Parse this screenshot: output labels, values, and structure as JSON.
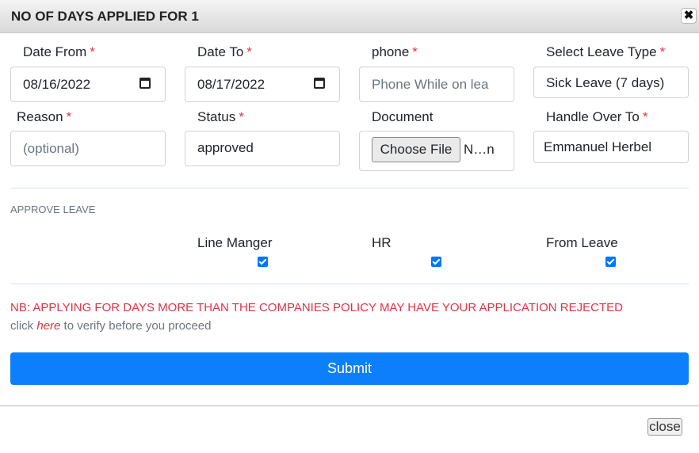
{
  "dialog": {
    "title": "NO OF DAYS APPLIED FOR 1",
    "close_x": "✖"
  },
  "form": {
    "date_from": {
      "label": "Date From",
      "value": "08/16/2022"
    },
    "date_to": {
      "label": "Date To",
      "value": "08/17/2022"
    },
    "phone": {
      "label": "phone",
      "placeholder": "Phone While on lea"
    },
    "leave_type": {
      "label": "Select Leave Type",
      "value": "Sick Leave (7 days)"
    },
    "reason": {
      "label": "Reason",
      "placeholder": "(optional)"
    },
    "status": {
      "label": "Status",
      "value": "approved"
    },
    "document": {
      "label": "Document",
      "button": "Choose File",
      "filename": "N…n"
    },
    "handle_over": {
      "label": "Handle Over To",
      "value": "Emmanuel Herbel"
    },
    "required_mark": "*"
  },
  "approve": {
    "section_title": "APPROVE LEAVE",
    "line_manager": {
      "label": "Line Manger",
      "checked": true
    },
    "hr": {
      "label": "HR",
      "checked": true
    },
    "from_leave": {
      "label": "From Leave",
      "checked": true
    }
  },
  "notice": {
    "warning": "NB: APPLYING FOR DAYS MORE THAN THE COMPANIES POLICY MAY HAVE YOUR APPLICATION REJECTED",
    "click_prefix": "click",
    "link": "here",
    "click_suffix": "to verify before you proceed"
  },
  "buttons": {
    "submit": "Submit",
    "close": "close"
  },
  "colors": {
    "primary": "#0d7ffd",
    "danger": "#dc3545",
    "checkbox": "#0075ff"
  },
  "icons": {
    "calendar": "calendar-icon",
    "close": "close-icon"
  }
}
